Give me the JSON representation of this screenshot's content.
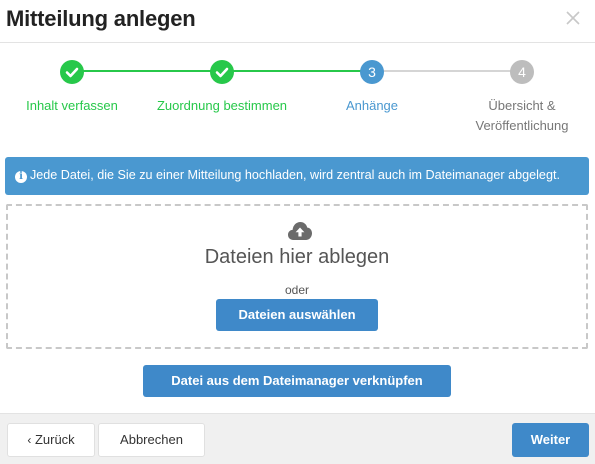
{
  "dialog": {
    "title": "Mitteilung anlegen",
    "close_icon": "close-icon"
  },
  "colors": {
    "done": "#27c84a",
    "active": "#4a98d0",
    "pending": "#bdbdbd",
    "primary": "#3f89c9"
  },
  "steps": [
    {
      "number": "1",
      "label": "Inhalt verfassen",
      "state": "done"
    },
    {
      "number": "2",
      "label": "Zuordnung bestimmen",
      "state": "done"
    },
    {
      "number": "3",
      "label": "Anhänge",
      "state": "active"
    },
    {
      "number": "4",
      "label_line1": "Übersicht &",
      "label_line2": "Veröffentlichung",
      "state": "pending"
    }
  ],
  "info": {
    "text": "Jede Datei, die Sie zu einer Mitteilung hochladen, wird zentral auch im Dateimanager abgelegt.",
    "icon": "info-icon"
  },
  "dropzone": {
    "icon": "cloud-upload-icon",
    "text": "Dateien hier ablegen",
    "or": "oder",
    "select_button": "Dateien auswählen"
  },
  "link_button": "Datei aus dem Dateimanager verknüpfen",
  "footer": {
    "back": "Zurück",
    "cancel": "Abbrechen",
    "next": "Weiter"
  }
}
